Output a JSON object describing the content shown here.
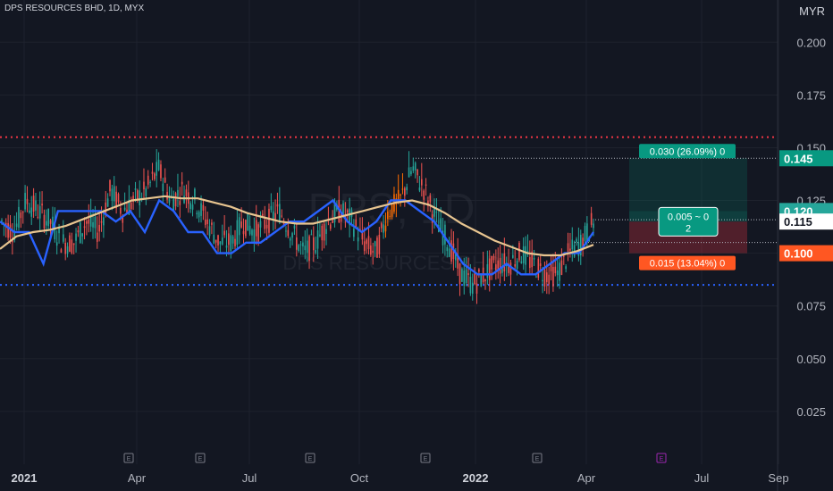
{
  "header": {
    "symbol_line": "DPS RESOURCES BHD, 1D, MYX",
    "currency": "MYR"
  },
  "watermark": {
    "symbol": "DPS, 1D",
    "name": "DPS RESOURCES BHD"
  },
  "colors": {
    "up": "#26a69a",
    "down": "#ef5350",
    "highlight": "#ff6d00",
    "ma_blue": "#2962ff",
    "ma_sand": "#e8c590",
    "target": "#089981",
    "stop": "#f23645",
    "stop_label": "#f7525f"
  },
  "chart_data": {
    "type": "line",
    "title": "",
    "ylim": [
      0.0,
      0.22
    ],
    "y_ticks": [
      "0.025",
      "0.050",
      "0.075",
      "0.100",
      "0.125",
      "0.150",
      "0.175",
      "0.200"
    ],
    "x_ticks": [
      "2021",
      "Apr",
      "Jul",
      "Oct",
      "2022",
      "Apr",
      "Jul",
      "Sep"
    ],
    "x_ticks_bold": [
      "2021",
      "2022"
    ],
    "event_markers": [
      "E",
      "E",
      "E",
      "E",
      "E",
      "E"
    ],
    "levels": {
      "resistance": 0.155,
      "support": 0.085
    },
    "position": {
      "target_price": 0.145,
      "entry_price": 0.12,
      "current_price": 0.115,
      "stop_price": 0.1,
      "target_label": "0.030 (26.09%) 0",
      "stop_label": "0.015 (13.04%) 0",
      "center_label_line1": "0.005 ~ 0",
      "center_label_line2": "2"
    },
    "price_labels": [
      "0.145",
      "0.120",
      "0.115",
      "0.100"
    ],
    "series": [
      {
        "values": [
          0.115,
          0.11,
          0.125,
          0.12,
          0.115,
          0.105,
          0.105,
          0.115,
          0.11,
          0.13,
          0.12,
          0.125,
          0.13,
          0.14,
          0.125,
          0.13,
          0.125,
          0.115,
          0.105,
          0.105,
          0.115,
          0.11,
          0.115,
          0.12,
          0.11,
          0.1,
          0.105,
          0.115,
          0.12,
          0.115,
          0.105,
          0.1,
          0.12,
          0.125,
          0.14,
          0.13,
          0.115,
          0.105,
          0.09,
          0.085,
          0.09,
          0.095,
          0.095,
          0.1,
          0.095,
          0.09,
          0.09,
          0.1,
          0.105,
          0.115
        ]
      },
      {
        "values": [
          0.115,
          0.11,
          0.11,
          0.095,
          0.12,
          0.12,
          0.12,
          0.12,
          0.115,
          0.12,
          0.11,
          0.125,
          0.12,
          0.11,
          0.11,
          0.1,
          0.1,
          0.105,
          0.105,
          0.11,
          0.115,
          0.115,
          0.12,
          0.125,
          0.115,
          0.11,
          0.115,
          0.125,
          0.125,
          0.12,
          0.115,
          0.105,
          0.095,
          0.09,
          0.09,
          0.095,
          0.09,
          0.09,
          0.095,
          0.1,
          0.1,
          0.11
        ]
      },
      {
        "values": [
          0.102,
          0.108,
          0.11,
          0.111,
          0.113,
          0.116,
          0.119,
          0.122,
          0.125,
          0.126,
          0.127,
          0.126,
          0.126,
          0.124,
          0.122,
          0.119,
          0.117,
          0.115,
          0.114,
          0.114,
          0.116,
          0.118,
          0.12,
          0.122,
          0.124,
          0.125,
          0.123,
          0.119,
          0.114,
          0.11,
          0.106,
          0.103,
          0.1,
          0.099,
          0.099,
          0.101,
          0.104
        ]
      }
    ]
  }
}
